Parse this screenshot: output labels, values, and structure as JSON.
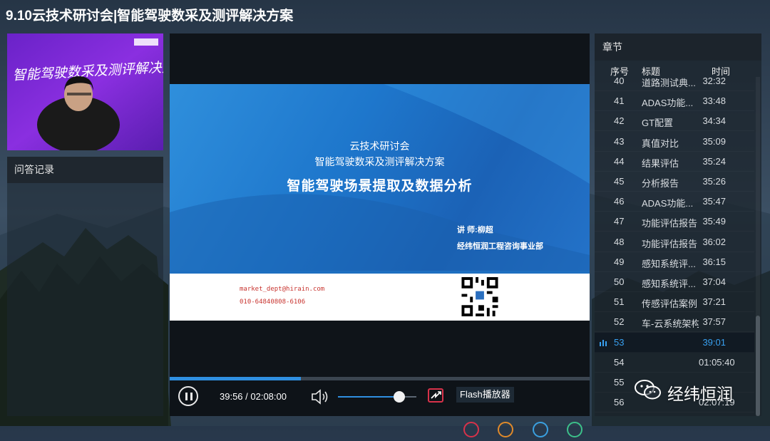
{
  "title": "9.10云技术研讨会|智能驾驶数采及测评解决方案",
  "camera": {
    "banner_text": "智能驾驶数采及测评解决方案"
  },
  "qa": {
    "header": "问答记录"
  },
  "slide": {
    "line1": "云技术研讨会",
    "line2": "智能驾驶数采及测评解决方案",
    "line3": "智能驾驶场景提取及数据分析",
    "lecturer": "讲 师:柳超",
    "company": "经纬恒润工程咨询事业部",
    "email": "market_dept@hirain.com",
    "phone": "010-64840808-6106"
  },
  "player": {
    "time_display": "39:56 / 02:08:00",
    "progress_fraction": 0.312,
    "volume_fraction": 0.78,
    "flash_label": "Flash播放器"
  },
  "chapters": {
    "header": "章节",
    "col_no": "序号",
    "col_title": "标题",
    "col_time": "时间",
    "active_no": "53",
    "rows": [
      {
        "no": "40",
        "title": "道路测试典...",
        "time": "32:32"
      },
      {
        "no": "41",
        "title": "ADAS功能...",
        "time": "33:48"
      },
      {
        "no": "42",
        "title": "GT配置",
        "time": "34:34"
      },
      {
        "no": "43",
        "title": "真值对比",
        "time": "35:09"
      },
      {
        "no": "44",
        "title": "结果评估",
        "time": "35:24"
      },
      {
        "no": "45",
        "title": "分析报告",
        "time": "35:26"
      },
      {
        "no": "46",
        "title": "ADAS功能...",
        "time": "35:47"
      },
      {
        "no": "47",
        "title": "功能评估报告",
        "time": "35:49"
      },
      {
        "no": "48",
        "title": "功能评估报告",
        "time": "36:02"
      },
      {
        "no": "49",
        "title": "感知系统评...",
        "time": "36:15"
      },
      {
        "no": "50",
        "title": "感知系统评...",
        "time": "37:04"
      },
      {
        "no": "51",
        "title": "传感评估案例",
        "time": "37:21"
      },
      {
        "no": "52",
        "title": "车-云系统架构",
        "time": "37:57"
      },
      {
        "no": "53",
        "title": "",
        "time": "39:01"
      },
      {
        "no": "54",
        "title": "",
        "time": "01:05:40"
      },
      {
        "no": "55",
        "title": "",
        "time": ""
      },
      {
        "no": "56",
        "title": "",
        "time": "02:07:19"
      }
    ]
  },
  "watermark": {
    "text": "经纬恒润"
  },
  "colors": {
    "accent": "#2f8fe0",
    "active_chapter": "#38a0f0",
    "flash_icon": "#d8324a",
    "contact_text": "#c8342f"
  }
}
